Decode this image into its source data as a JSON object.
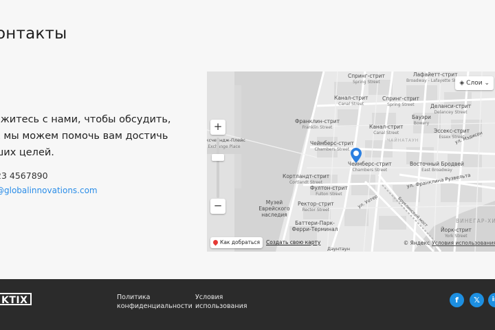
{
  "page": {
    "title": "онтакты"
  },
  "contact": {
    "text_lines": [
      "яжитесь с нами, чтобы обсудить,",
      "к мы можем помочь вам достичь",
      "ших целей."
    ],
    "phone": "23 4567890",
    "email": "@globalinnovations.com"
  },
  "map": {
    "layers_label": "Слои",
    "route_label": "Как добраться",
    "create_map_label": "Создать свою карту",
    "copyright": "© Яндекс",
    "terms_label": "Условия использования",
    "labels": [
      {
        "ru": "Спринг-стрит",
        "en": "Spring Street"
      },
      {
        "ru": "Лафайетт-стрит",
        "en": "Broadway - Lafayette Street"
      },
      {
        "ru": "Канал-стрит",
        "en": "Canal Street"
      },
      {
        "ru": "Спринг-стрит",
        "en": "Spring Street"
      },
      {
        "ru": "Деланси-стрит",
        "en": "Delancey Street"
      },
      {
        "ru": "Франклин-стрит",
        "en": "Franklin Street"
      },
      {
        "ru": "Канал-стрит",
        "en": "Canal Street"
      },
      {
        "ru": "Бауэри",
        "en": "Bowery"
      },
      {
        "ru": "Эссекс-стрит",
        "en": "Essex Street"
      },
      {
        "ru": "Чеймберс-стрит",
        "en": "Chambers Street"
      },
      {
        "ru": "Чеймберс-стрит",
        "en": "Chambers Street"
      },
      {
        "ru": "Восточный Бродвей",
        "en": "East Broadway"
      },
      {
        "ru": "Кортландт-стрит",
        "en": "Cortlandt Street"
      },
      {
        "ru": "Фултон-стрит",
        "en": "Fulton Street"
      },
      {
        "ru": "Ректор-стрит",
        "en": "Rector Street"
      },
      {
        "ru": "Музей Еврейского наследия",
        "en": ""
      },
      {
        "ru": "Баттери-Парк-Ферри-Терминал",
        "en": ""
      },
      {
        "ru": "Йорк-стрит",
        "en": "York Street"
      },
      {
        "ru": "ВИНЕГАР-ХИ",
        "en": ""
      },
      {
        "ru": "ЧАЙНАТАУН",
        "en": ""
      },
      {
        "ru": "ул. Франклина Рузвельта",
        "en": ""
      },
      {
        "ru": "ул. Мэдисон",
        "en": ""
      },
      {
        "ru": "Бруклинский мост",
        "en": ""
      },
      {
        "ru": "ул. Уотер",
        "en": ""
      },
      {
        "ru": "Даунтаун",
        "en": ""
      },
      {
        "ru": "Эксчейндж-Плейс",
        "en": "Exchange Place"
      }
    ]
  },
  "footer": {
    "logo": "KTIX",
    "privacy_line1": "Политика",
    "privacy_line2": "конфиденциальности",
    "terms_line1": "Условия",
    "terms_line2": "использования",
    "social": [
      "f",
      "𝕏",
      "in"
    ]
  },
  "colors": {
    "accent": "#1d8fe1",
    "footer_bg": "#2b2b2b",
    "link": "#2a8de8",
    "marker": "#2b7fe0"
  }
}
